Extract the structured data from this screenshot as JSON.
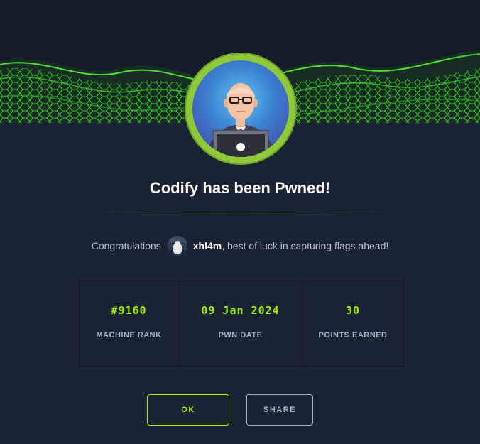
{
  "header": {
    "banner_icon": "green-hex-wave-banner",
    "avatar_icon": "machine-avatar-icon"
  },
  "title": "Codify has been Pwned!",
  "congrats": {
    "prefix": "Congratulations",
    "username": "xhl4m",
    "suffix": ", best of luck in capturing flags ahead!",
    "user_avatar_icon": "user-avatar-icon"
  },
  "stats": [
    {
      "value": "#9160",
      "label": "MACHINE RANK"
    },
    {
      "value": "09 Jan 2024",
      "label": "PWN DATE"
    },
    {
      "value": "30",
      "label": "POINTS EARNED"
    }
  ],
  "buttons": {
    "ok": "OK",
    "share": "SHARE"
  },
  "colors": {
    "background": "#1a2332",
    "accent": "#9fef00",
    "muted": "#a4b1cd",
    "ring": "#8fc93a"
  }
}
